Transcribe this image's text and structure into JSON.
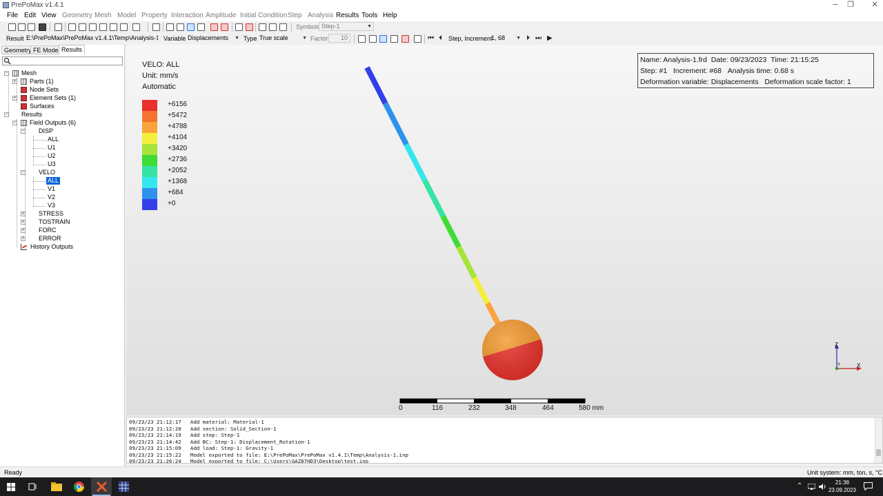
{
  "window": {
    "title": "PrePoMax v1.4.1",
    "minimize": "─",
    "maximize": "❐",
    "close": "✕"
  },
  "menu": [
    "File",
    "Edit",
    "View",
    "Geometry",
    "Mesh",
    "Model",
    "Property",
    "Interaction",
    "Amplitude",
    "Initial Condition",
    "Step",
    "Analysis",
    "Results",
    "Tools",
    "Help"
  ],
  "toolbar1": {
    "symbols_label": "Symbols",
    "step_value": "Step-1"
  },
  "toolbar2": {
    "result_label": "Result",
    "result_value": "E:\\PrePoMax\\PrePoMax v1.4.1\\Temp\\Analysis-1.frd",
    "variable_label": "Variable",
    "variable_value": "Displacements",
    "type_label": "Type",
    "type_value": "True scale",
    "factor_label": "Factor",
    "factor_value": "10",
    "increment_label": "Step, Increment",
    "increment_value": "1, 68"
  },
  "panel_tabs": [
    "Geometry",
    "FE Model",
    "Results"
  ],
  "tree": {
    "mesh": "Mesh",
    "parts": "Parts (1)",
    "node_sets": "Node Sets",
    "element_sets": "Element Sets (1)",
    "surfaces": "Surfaces",
    "results": "Results",
    "field_outputs": "Field Outputs (6)",
    "disp": "DISP",
    "disp_all": "ALL",
    "u1": "U1",
    "u2": "U2",
    "u3": "U3",
    "velo": "VELO",
    "velo_all": "ALL",
    "v1": "V1",
    "v2": "V2",
    "v3": "V3",
    "stress": "STRESS",
    "tostrain": "TOSTRAIN",
    "forc": "FORC",
    "error": "ERROR",
    "history_outputs": "History Outputs"
  },
  "legend": {
    "title": "VELO: ALL",
    "unit": "Unit: mm/s",
    "mode": "Automatic",
    "entries": [
      {
        "label": "+6156",
        "color": "#e8312a"
      },
      {
        "label": "+5472",
        "color": "#f5732e"
      },
      {
        "label": "+4788",
        "color": "#f9a53a"
      },
      {
        "label": "+4104",
        "color": "#f3ef3c"
      },
      {
        "label": "+3420",
        "color": "#a6e43a"
      },
      {
        "label": "+2736",
        "color": "#3fdc35"
      },
      {
        "label": "+2052",
        "color": "#35e3a3"
      },
      {
        "label": "+1368",
        "color": "#36e6ee"
      },
      {
        "label": "+684",
        "color": "#2f92ea"
      },
      {
        "label": "+0",
        "color": "#3340e8"
      }
    ]
  },
  "info": {
    "name": "Name: Analysis-1.frd",
    "date": "Date: 09/23/2023",
    "time": "Time: 21:15:25",
    "step": "Step: #1",
    "increment": "Increment: #68",
    "analysis_time": "Analysis time: 0.68 s",
    "deformation_variable": "Deformation variable: Displacements",
    "deformation_scale": "Deformation scale factor: 1"
  },
  "scale_bar": [
    "0",
    "116",
    "232",
    "348",
    "464",
    "580 mm"
  ],
  "triad": {
    "z": "Z",
    "y": "Y",
    "x": "X"
  },
  "log": [
    "09/23/23 21:12:17   Add material: Material-1",
    "09/23/23 21:12:20   Add section: Solid_Section-1",
    "09/23/23 21:14:19   Add step: Step-1",
    "09/23/23 21:14:42   Add BC: Step-1: Displacement_Rotation-1",
    "09/23/23 21:15:09   Add load: Step-1: Gravity-1",
    "09/23/23 21:15:22   Model exported to file: E:\\PrePoMax\\PrePoMax v1.4.1\\Temp\\Analysis-1.inp",
    "09/23/23 21:26:24   Model exported to file: C:\\Users\\GAZ87HD3\\Desktop\\test.inp"
  ],
  "status": {
    "left": "Ready",
    "right": "Unit system: mm, ton, s, °C"
  },
  "taskbar": {
    "time": "21:38",
    "date": "23.09.2023"
  },
  "colors": {
    "accent": "#0a64d8",
    "background_top": "#f7f7f7",
    "background_bottom": "#dedede"
  }
}
